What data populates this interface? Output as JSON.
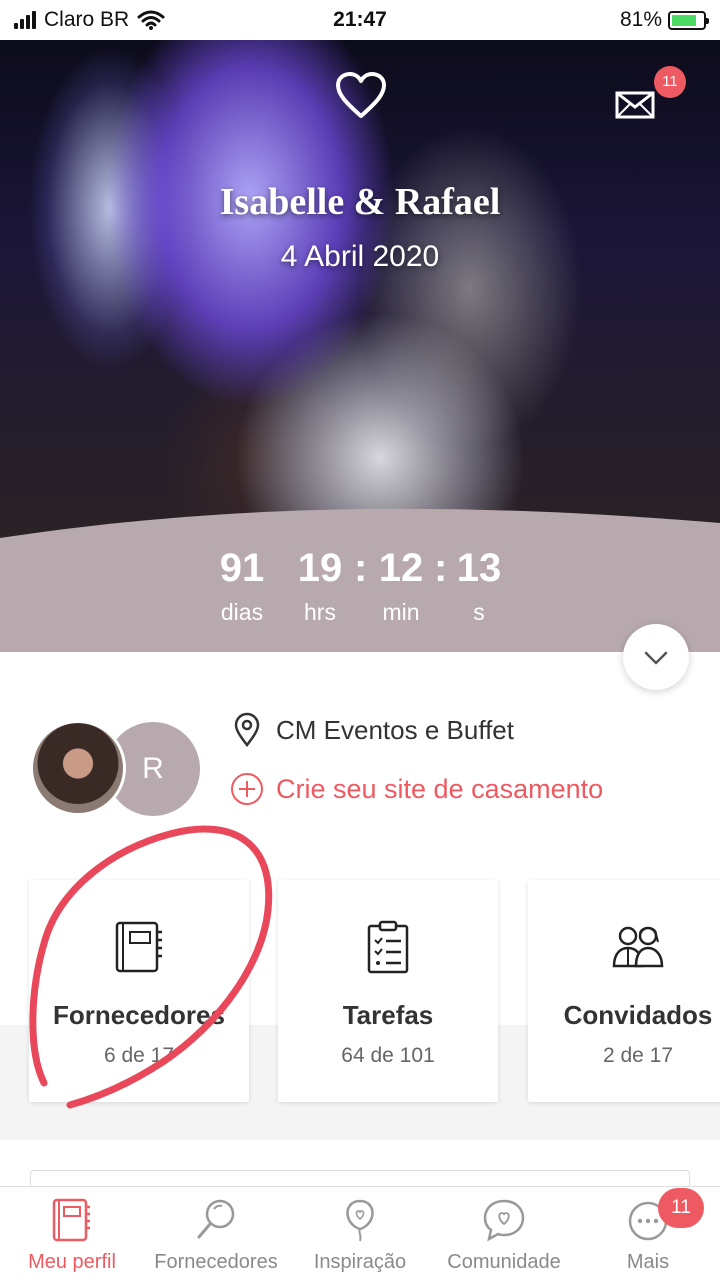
{
  "status_bar": {
    "carrier": "Claro BR",
    "time": "21:47",
    "battery": "81%",
    "battery_level": 0.81
  },
  "hero": {
    "couple_names": "Isabelle & Rafael",
    "wedding_date": "4 Abril 2020",
    "mail_badge": "11",
    "countdown": {
      "days": "91",
      "days_label": "dias",
      "hours": "19",
      "hours_label": "hrs",
      "minutes": "12",
      "minutes_label": "min",
      "seconds": "13",
      "seconds_label": "s",
      "separator": ":"
    }
  },
  "profile": {
    "partner_initial": "R",
    "venue": "CM Eventos e Buffet",
    "create_site": "Crie seu site de casamento"
  },
  "cards": [
    {
      "title": "Fornecedores",
      "count": "6 de 17",
      "icon": "notebook-icon"
    },
    {
      "title": "Tarefas",
      "count": "64 de 101",
      "icon": "checklist-icon"
    },
    {
      "title": "Convidados",
      "count": "2 de 17",
      "icon": "guests-icon"
    }
  ],
  "bottom_nav": {
    "items": [
      {
        "label": "Meu perfil",
        "icon": "notebook-icon",
        "active": true
      },
      {
        "label": "Fornecedores",
        "icon": "search-icon",
        "active": false
      },
      {
        "label": "Inspiração",
        "icon": "balloon-heart-icon",
        "active": false
      },
      {
        "label": "Comunidade",
        "icon": "chat-heart-icon",
        "active": false
      },
      {
        "label": "Mais",
        "icon": "more-icon",
        "active": false
      }
    ],
    "more_badge": "11"
  },
  "colors": {
    "accent": "#ee5a61",
    "hero_band": "#b7a9ae",
    "text": "#333333",
    "muted": "#8a8a8a"
  }
}
